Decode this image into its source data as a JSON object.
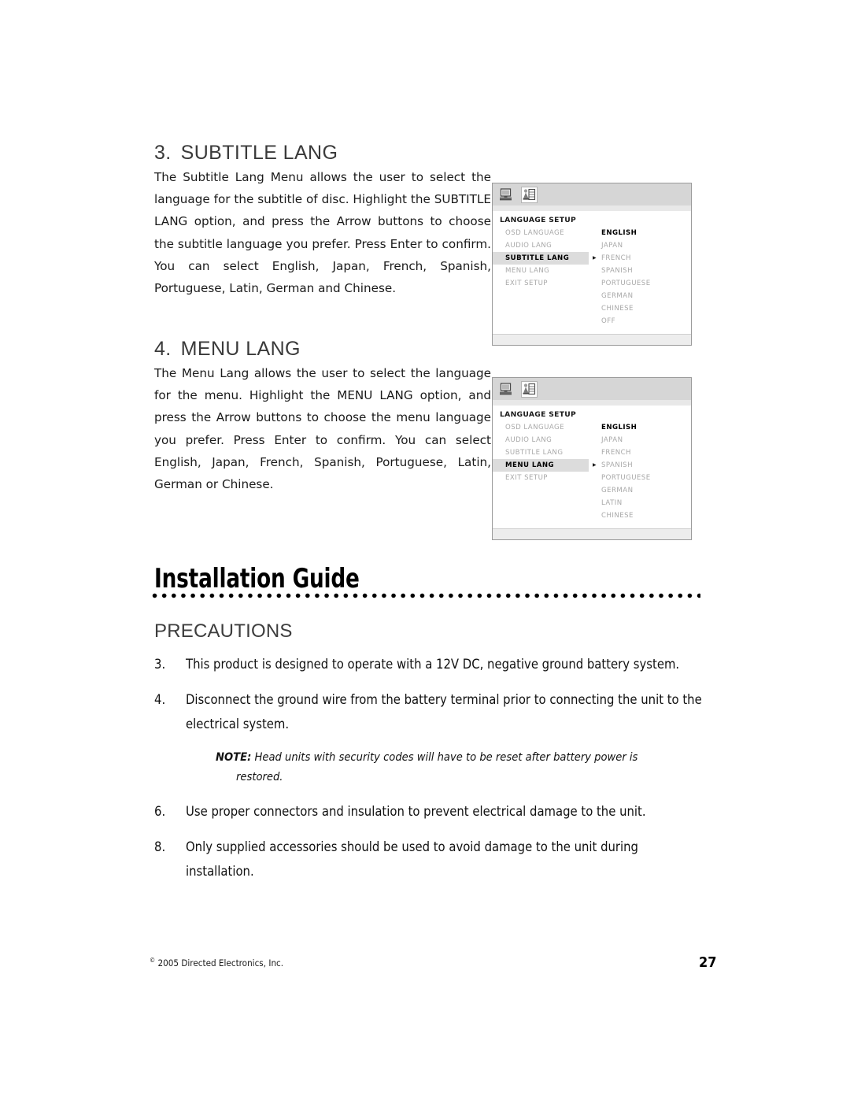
{
  "sections": [
    {
      "number": "3.",
      "title": "SUBTITLE LANG",
      "body": "The Subtitle Lang Menu allows the user to select the language for the subtitle of disc. Highlight the SUBTITLE LANG option, and press the Arrow buttons to choose the subtitle language you prefer. Press Enter to confirm. You can select English, Japan, French, Spanish, Portuguese, Latin, German and Chinese."
    },
    {
      "number": "4.",
      "title": "MENU LANG",
      "body": "The Menu Lang allows the user to select the language for the menu. Highlight the MENU LANG option, and press the Arrow buttons to choose the menu language you prefer. Press Enter to confirm. You can select English, Japan, French, Spanish, Portuguese, Latin, German or Chinese."
    }
  ],
  "osd_panels": [
    {
      "heading": "LANGUAGE  SETUP",
      "tabs": [
        {
          "icon": "monitor-icon",
          "active": false
        },
        {
          "icon": "display-setup-icon",
          "active": true
        }
      ],
      "menu_items": [
        {
          "label": "OSD  LANGUAGE",
          "selected": false
        },
        {
          "label": "AUDIO  LANG",
          "selected": false
        },
        {
          "label": "SUBTITLE LANG",
          "selected": true
        },
        {
          "label": "MENU  LANG",
          "selected": false
        },
        {
          "label": "EXIT  SETUP",
          "selected": false
        }
      ],
      "options": [
        {
          "label": "ENGLISH",
          "current": true,
          "cursor": false
        },
        {
          "label": "JAPAN",
          "current": false,
          "cursor": false
        },
        {
          "label": "FRENCH",
          "current": false,
          "cursor": true
        },
        {
          "label": "SPANISH",
          "current": false,
          "cursor": false
        },
        {
          "label": "PORTUGUESE",
          "current": false,
          "cursor": false
        },
        {
          "label": "GERMAN",
          "current": false,
          "cursor": false
        },
        {
          "label": "CHINESE",
          "current": false,
          "cursor": false
        },
        {
          "label": "OFF",
          "current": false,
          "cursor": false
        }
      ]
    },
    {
      "heading": "LANGUAGE  SETUP",
      "tabs": [
        {
          "icon": "monitor-icon",
          "active": false
        },
        {
          "icon": "display-setup-icon",
          "active": true
        }
      ],
      "menu_items": [
        {
          "label": "OSD  LANGUAGE",
          "selected": false
        },
        {
          "label": "AUDIO  LANG",
          "selected": false
        },
        {
          "label": "SUBTITLE LANG",
          "selected": false
        },
        {
          "label": "MENU  LANG",
          "selected": true
        },
        {
          "label": "EXIT  SETUP",
          "selected": false
        }
      ],
      "options": [
        {
          "label": "ENGLISH",
          "current": true,
          "cursor": false
        },
        {
          "label": "JAPAN",
          "current": false,
          "cursor": false
        },
        {
          "label": "FRENCH",
          "current": false,
          "cursor": false
        },
        {
          "label": "SPANISH",
          "current": false,
          "cursor": true
        },
        {
          "label": "PORTUGUESE",
          "current": false,
          "cursor": false
        },
        {
          "label": "GERMAN",
          "current": false,
          "cursor": false
        },
        {
          "label": "LATIN",
          "current": false,
          "cursor": false
        },
        {
          "label": "CHINESE",
          "current": false,
          "cursor": false
        }
      ]
    }
  ],
  "guide": {
    "title": "Installation Guide"
  },
  "precautions": {
    "heading": "PRECAUTIONS",
    "items": [
      {
        "number": "3.",
        "text": "This product is designed to operate with a 12V DC, negative ground battery system."
      },
      {
        "number": "4.",
        "text": "Disconnect the ground wire from the battery terminal prior to connecting the unit to the electrical system."
      }
    ],
    "note": {
      "label": "NOTE:",
      "line1": "Head units with security codes will have to be reset after battery power is",
      "line2": "restored."
    },
    "items_after_note": [
      {
        "number": "6.",
        "text": "Use proper connectors and insulation to prevent electrical damage to the unit."
      },
      {
        "number": "8.",
        "text": "Only supplied accessories should be used to avoid damage to the unit during installation."
      }
    ]
  },
  "footer": {
    "copyright_symbol": "©",
    "copyright": " 2005 Directed Electronics, Inc.",
    "page_number": "27"
  },
  "colors": {
    "osd_tabbar": "#d6d6d6",
    "osd_highlight": "#dcdcdc",
    "osd_dim_text": "#a8a8a8",
    "heading_gray": "#3a3a3a"
  }
}
